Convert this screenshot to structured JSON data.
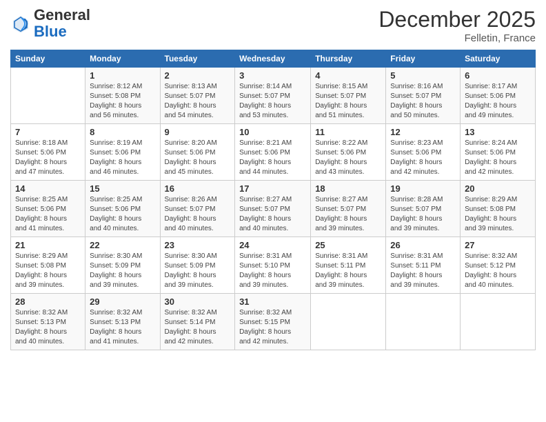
{
  "header": {
    "logo_line1": "General",
    "logo_line2": "Blue",
    "month": "December 2025",
    "location": "Felletin, France"
  },
  "columns": [
    "Sunday",
    "Monday",
    "Tuesday",
    "Wednesday",
    "Thursday",
    "Friday",
    "Saturday"
  ],
  "weeks": [
    [
      {
        "day": "",
        "info": ""
      },
      {
        "day": "1",
        "info": "Sunrise: 8:12 AM\nSunset: 5:08 PM\nDaylight: 8 hours\nand 56 minutes."
      },
      {
        "day": "2",
        "info": "Sunrise: 8:13 AM\nSunset: 5:07 PM\nDaylight: 8 hours\nand 54 minutes."
      },
      {
        "day": "3",
        "info": "Sunrise: 8:14 AM\nSunset: 5:07 PM\nDaylight: 8 hours\nand 53 minutes."
      },
      {
        "day": "4",
        "info": "Sunrise: 8:15 AM\nSunset: 5:07 PM\nDaylight: 8 hours\nand 51 minutes."
      },
      {
        "day": "5",
        "info": "Sunrise: 8:16 AM\nSunset: 5:07 PM\nDaylight: 8 hours\nand 50 minutes."
      },
      {
        "day": "6",
        "info": "Sunrise: 8:17 AM\nSunset: 5:06 PM\nDaylight: 8 hours\nand 49 minutes."
      }
    ],
    [
      {
        "day": "7",
        "info": "Sunrise: 8:18 AM\nSunset: 5:06 PM\nDaylight: 8 hours\nand 47 minutes."
      },
      {
        "day": "8",
        "info": "Sunrise: 8:19 AM\nSunset: 5:06 PM\nDaylight: 8 hours\nand 46 minutes."
      },
      {
        "day": "9",
        "info": "Sunrise: 8:20 AM\nSunset: 5:06 PM\nDaylight: 8 hours\nand 45 minutes."
      },
      {
        "day": "10",
        "info": "Sunrise: 8:21 AM\nSunset: 5:06 PM\nDaylight: 8 hours\nand 44 minutes."
      },
      {
        "day": "11",
        "info": "Sunrise: 8:22 AM\nSunset: 5:06 PM\nDaylight: 8 hours\nand 43 minutes."
      },
      {
        "day": "12",
        "info": "Sunrise: 8:23 AM\nSunset: 5:06 PM\nDaylight: 8 hours\nand 42 minutes."
      },
      {
        "day": "13",
        "info": "Sunrise: 8:24 AM\nSunset: 5:06 PM\nDaylight: 8 hours\nand 42 minutes."
      }
    ],
    [
      {
        "day": "14",
        "info": "Sunrise: 8:25 AM\nSunset: 5:06 PM\nDaylight: 8 hours\nand 41 minutes."
      },
      {
        "day": "15",
        "info": "Sunrise: 8:25 AM\nSunset: 5:06 PM\nDaylight: 8 hours\nand 40 minutes."
      },
      {
        "day": "16",
        "info": "Sunrise: 8:26 AM\nSunset: 5:07 PM\nDaylight: 8 hours\nand 40 minutes."
      },
      {
        "day": "17",
        "info": "Sunrise: 8:27 AM\nSunset: 5:07 PM\nDaylight: 8 hours\nand 40 minutes."
      },
      {
        "day": "18",
        "info": "Sunrise: 8:27 AM\nSunset: 5:07 PM\nDaylight: 8 hours\nand 39 minutes."
      },
      {
        "day": "19",
        "info": "Sunrise: 8:28 AM\nSunset: 5:07 PM\nDaylight: 8 hours\nand 39 minutes."
      },
      {
        "day": "20",
        "info": "Sunrise: 8:29 AM\nSunset: 5:08 PM\nDaylight: 8 hours\nand 39 minutes."
      }
    ],
    [
      {
        "day": "21",
        "info": "Sunrise: 8:29 AM\nSunset: 5:08 PM\nDaylight: 8 hours\nand 39 minutes."
      },
      {
        "day": "22",
        "info": "Sunrise: 8:30 AM\nSunset: 5:09 PM\nDaylight: 8 hours\nand 39 minutes."
      },
      {
        "day": "23",
        "info": "Sunrise: 8:30 AM\nSunset: 5:09 PM\nDaylight: 8 hours\nand 39 minutes."
      },
      {
        "day": "24",
        "info": "Sunrise: 8:31 AM\nSunset: 5:10 PM\nDaylight: 8 hours\nand 39 minutes."
      },
      {
        "day": "25",
        "info": "Sunrise: 8:31 AM\nSunset: 5:11 PM\nDaylight: 8 hours\nand 39 minutes."
      },
      {
        "day": "26",
        "info": "Sunrise: 8:31 AM\nSunset: 5:11 PM\nDaylight: 8 hours\nand 39 minutes."
      },
      {
        "day": "27",
        "info": "Sunrise: 8:32 AM\nSunset: 5:12 PM\nDaylight: 8 hours\nand 40 minutes."
      }
    ],
    [
      {
        "day": "28",
        "info": "Sunrise: 8:32 AM\nSunset: 5:13 PM\nDaylight: 8 hours\nand 40 minutes."
      },
      {
        "day": "29",
        "info": "Sunrise: 8:32 AM\nSunset: 5:13 PM\nDaylight: 8 hours\nand 41 minutes."
      },
      {
        "day": "30",
        "info": "Sunrise: 8:32 AM\nSunset: 5:14 PM\nDaylight: 8 hours\nand 42 minutes."
      },
      {
        "day": "31",
        "info": "Sunrise: 8:32 AM\nSunset: 5:15 PM\nDaylight: 8 hours\nand 42 minutes."
      },
      {
        "day": "",
        "info": ""
      },
      {
        "day": "",
        "info": ""
      },
      {
        "day": "",
        "info": ""
      }
    ]
  ]
}
